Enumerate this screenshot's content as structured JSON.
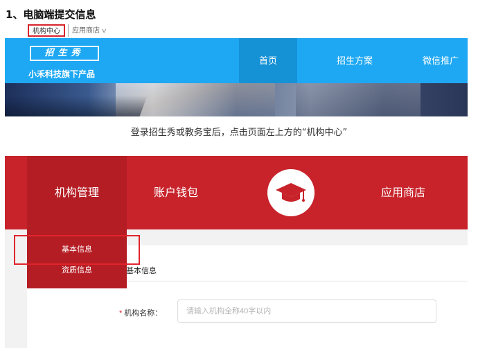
{
  "step_heading": "1、电脑端提交信息",
  "top_nav": {
    "org_center": "机构中心",
    "app_store": "应用商店",
    "chevron": "∨"
  },
  "site_header": {
    "logo_text": "招生秀",
    "logo_subtitle": "小禾科技旗下产品",
    "nav": [
      "首页",
      "招生方案",
      "微信推广"
    ],
    "background_color": "#1ea8f3"
  },
  "caption": "登录招生秀或教务宝后，点击页面左上方的“机构中心”",
  "org_header": {
    "nav_org_mgmt": "机构管理",
    "nav_wallet": "账户钱包",
    "nav_app_store": "应用商店",
    "center_icon": "graduation-cap-icon",
    "background_color": "#c8232b"
  },
  "dropdown": {
    "items": [
      "基本信息",
      "资质信息"
    ]
  },
  "content": {
    "tab_title": "基本信息",
    "form": {
      "org_name_label": "机构名称：",
      "required_mark": "*",
      "org_name_placeholder": "请输入机构全称40字以内",
      "org_name_value": ""
    }
  },
  "highlight_color": "#e0242c"
}
